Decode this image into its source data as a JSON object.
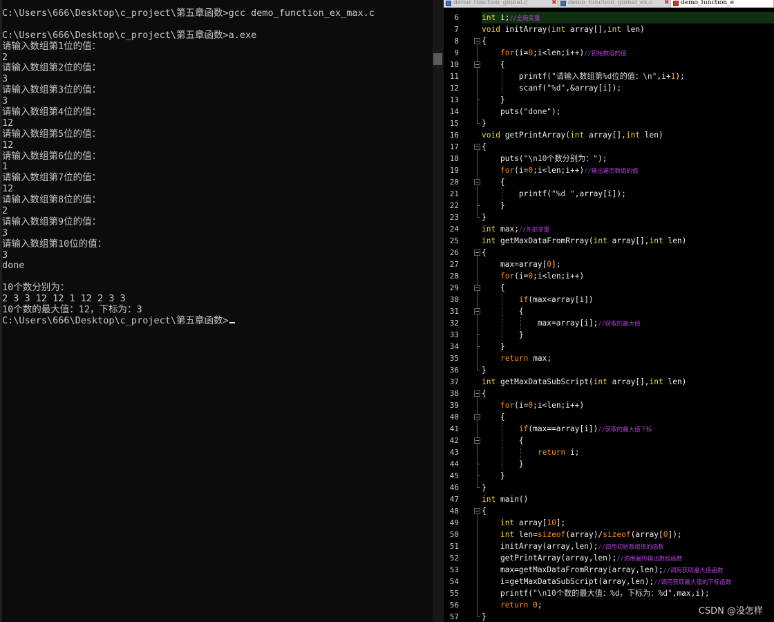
{
  "console": {
    "lines": [
      "C:\\Users\\666\\Desktop\\c_project\\第五章函数>gcc demo_function_ex_max.c",
      "",
      "C:\\Users\\666\\Desktop\\c_project\\第五章函数>a.exe",
      "请输入数组第1位的值：",
      "2",
      "请输入数组第2位的值：",
      "3",
      "请输入数组第3位的值：",
      "3",
      "请输入数组第4位的值：",
      "12",
      "请输入数组第5位的值：",
      "12",
      "请输入数组第6位的值：",
      "1",
      "请输入数组第7位的值：",
      "12",
      "请输入数组第8位的值：",
      "2",
      "请输入数组第9位的值：",
      "3",
      "请输入数组第10位的值：",
      "3",
      "done",
      "",
      "10个数分别为：",
      "2 3 3 12 12 1 12 2 3 3",
      "10个数的最大值：12，下标为：3",
      "C:\\Users\\666\\Desktop\\c_project\\第五章函数>"
    ]
  },
  "tabs": [
    {
      "label": "demo_function_global.c",
      "active": false
    },
    {
      "label": "demo_function_global_ex.c",
      "active": false
    },
    {
      "label": "demo_function_e",
      "active": true
    }
  ],
  "editor": {
    "lines": [
      {
        "n": "6",
        "t": [
          [
            "ty",
            "int"
          ],
          [
            "op",
            " i;"
          ],
          [
            "cm",
            "//全局变量"
          ]
        ]
      },
      {
        "n": "7",
        "t": [
          [
            "ty",
            "void"
          ],
          [
            "fn",
            " initArray("
          ],
          [
            "ty",
            "int"
          ],
          [
            "op",
            " array[],"
          ],
          [
            "ty",
            "int"
          ],
          [
            "op",
            " len)"
          ]
        ]
      },
      {
        "n": "8",
        "t": [
          [
            "op",
            "{"
          ]
        ]
      },
      {
        "n": "9",
        "t": [
          [
            "op",
            "    "
          ],
          [
            "kw",
            "for"
          ],
          [
            "op",
            "(i="
          ],
          [
            "num",
            "0"
          ],
          [
            "op",
            ";i<len;i++)"
          ],
          [
            "cm",
            "//初始数组的值"
          ]
        ]
      },
      {
        "n": "10",
        "t": [
          [
            "op",
            "    {"
          ]
        ]
      },
      {
        "n": "11",
        "t": [
          [
            "op",
            "        printf("
          ],
          [
            "str",
            "\"请输入数组第%d位的值：\\n\""
          ],
          [
            "op",
            ",i+"
          ],
          [
            "num",
            "1"
          ],
          [
            "op",
            ");"
          ]
        ]
      },
      {
        "n": "12",
        "t": [
          [
            "op",
            "        scanf("
          ],
          [
            "str",
            "\"%d\""
          ],
          [
            "op",
            ",&array[i]);"
          ]
        ]
      },
      {
        "n": "13",
        "t": [
          [
            "op",
            "    }"
          ]
        ]
      },
      {
        "n": "14",
        "t": [
          [
            "op",
            "    puts("
          ],
          [
            "str",
            "\"done\""
          ],
          [
            "op",
            ");"
          ]
        ]
      },
      {
        "n": "15",
        "t": [
          [
            "op",
            "}"
          ]
        ]
      },
      {
        "n": "16",
        "t": [
          [
            "ty",
            "void"
          ],
          [
            "fn",
            " getPrintArray("
          ],
          [
            "ty",
            "int"
          ],
          [
            "op",
            " array[],"
          ],
          [
            "ty",
            "int"
          ],
          [
            "op",
            " len)"
          ]
        ]
      },
      {
        "n": "17",
        "t": [
          [
            "op",
            "{"
          ]
        ]
      },
      {
        "n": "18",
        "t": [
          [
            "op",
            "    puts("
          ],
          [
            "str",
            "\"\\n10个数分别为：\""
          ],
          [
            "op",
            ");"
          ]
        ]
      },
      {
        "n": "19",
        "t": [
          [
            "op",
            "    "
          ],
          [
            "kw",
            "for"
          ],
          [
            "op",
            "(i="
          ],
          [
            "num",
            "0"
          ],
          [
            "op",
            ";i<len;i++)"
          ],
          [
            "cm",
            "//输出遍历数组的值"
          ]
        ]
      },
      {
        "n": "20",
        "t": [
          [
            "op",
            "    {"
          ]
        ]
      },
      {
        "n": "21",
        "t": [
          [
            "op",
            "        printf("
          ],
          [
            "str",
            "\"%d \""
          ],
          [
            "op",
            ",array[i]);"
          ]
        ]
      },
      {
        "n": "22",
        "t": [
          [
            "op",
            "    }"
          ]
        ]
      },
      {
        "n": "23",
        "t": [
          [
            "op",
            "}"
          ]
        ]
      },
      {
        "n": "24",
        "t": [
          [
            "ty",
            "int"
          ],
          [
            "op",
            " max;"
          ],
          [
            "cm",
            "//外部变量"
          ]
        ]
      },
      {
        "n": "25",
        "t": [
          [
            "ty",
            "int"
          ],
          [
            "fn",
            " getMaxDataFromRrray("
          ],
          [
            "ty",
            "int"
          ],
          [
            "op",
            " array[],"
          ],
          [
            "ty",
            "int"
          ],
          [
            "op",
            " len)"
          ]
        ]
      },
      {
        "n": "26",
        "t": [
          [
            "op",
            "{"
          ]
        ]
      },
      {
        "n": "27",
        "t": [
          [
            "op",
            "    max=array["
          ],
          [
            "num",
            "0"
          ],
          [
            "op",
            "];"
          ]
        ]
      },
      {
        "n": "28",
        "t": [
          [
            "op",
            "    "
          ],
          [
            "kw",
            "for"
          ],
          [
            "op",
            "(i="
          ],
          [
            "num",
            "0"
          ],
          [
            "op",
            ";i<len;i++)"
          ]
        ]
      },
      {
        "n": "29",
        "t": [
          [
            "op",
            "    {"
          ]
        ]
      },
      {
        "n": "30",
        "t": [
          [
            "op",
            "        "
          ],
          [
            "kw",
            "if"
          ],
          [
            "op",
            "(max<array[i])"
          ]
        ]
      },
      {
        "n": "31",
        "t": [
          [
            "op",
            "        {"
          ]
        ]
      },
      {
        "n": "32",
        "t": [
          [
            "op",
            "            max=array[i];"
          ],
          [
            "cm",
            "//获取的最大值"
          ]
        ]
      },
      {
        "n": "33",
        "t": [
          [
            "op",
            "        }"
          ]
        ]
      },
      {
        "n": "34",
        "t": [
          [
            "op",
            "    }"
          ]
        ]
      },
      {
        "n": "35",
        "t": [
          [
            "op",
            "    "
          ],
          [
            "kw",
            "return"
          ],
          [
            "op",
            " max;"
          ]
        ]
      },
      {
        "n": "36",
        "t": [
          [
            "op",
            "}"
          ]
        ]
      },
      {
        "n": "37",
        "t": [
          [
            "ty",
            "int"
          ],
          [
            "fn",
            " getMaxDataSubScript("
          ],
          [
            "ty",
            "int"
          ],
          [
            "op",
            " array[],"
          ],
          [
            "ty",
            "int"
          ],
          [
            "op",
            " len)"
          ]
        ]
      },
      {
        "n": "38",
        "t": [
          [
            "op",
            "{"
          ]
        ]
      },
      {
        "n": "39",
        "t": [
          [
            "op",
            "    "
          ],
          [
            "kw",
            "for"
          ],
          [
            "op",
            "(i="
          ],
          [
            "num",
            "0"
          ],
          [
            "op",
            ";i<len;i++)"
          ]
        ]
      },
      {
        "n": "40",
        "t": [
          [
            "op",
            "    {"
          ]
        ]
      },
      {
        "n": "41",
        "t": [
          [
            "op",
            "        "
          ],
          [
            "kw",
            "if"
          ],
          [
            "op",
            "(max==array[i])"
          ],
          [
            "cm",
            "//获取的最大值下标"
          ]
        ]
      },
      {
        "n": "42",
        "t": [
          [
            "op",
            "        {"
          ]
        ]
      },
      {
        "n": "43",
        "t": [
          [
            "op",
            "            "
          ],
          [
            "kw",
            "return"
          ],
          [
            "op",
            " i;"
          ]
        ]
      },
      {
        "n": "44",
        "t": [
          [
            "op",
            "        }"
          ]
        ]
      },
      {
        "n": "45",
        "t": [
          [
            "op",
            "    }"
          ]
        ]
      },
      {
        "n": "46",
        "t": [
          [
            "op",
            "}"
          ]
        ]
      },
      {
        "n": "47",
        "t": [
          [
            "ty",
            "int"
          ],
          [
            "fn",
            " main()"
          ]
        ]
      },
      {
        "n": "48",
        "t": [
          [
            "op",
            "{"
          ]
        ]
      },
      {
        "n": "49",
        "t": [
          [
            "op",
            "    "
          ],
          [
            "ty",
            "int"
          ],
          [
            "op",
            " array["
          ],
          [
            "num",
            "10"
          ],
          [
            "op",
            "];"
          ]
        ]
      },
      {
        "n": "50",
        "t": [
          [
            "op",
            "    "
          ],
          [
            "ty",
            "int"
          ],
          [
            "op",
            " len="
          ],
          [
            "kw",
            "sizeof"
          ],
          [
            "op",
            "(array)/"
          ],
          [
            "kw",
            "sizeof"
          ],
          [
            "op",
            "(array["
          ],
          [
            "num",
            "0"
          ],
          [
            "op",
            "]);"
          ]
        ]
      },
      {
        "n": "51",
        "t": [
          [
            "op",
            "    initArray(array,len);"
          ],
          [
            "cm",
            "//调用初始数组值的函数"
          ]
        ]
      },
      {
        "n": "52",
        "t": [
          [
            "op",
            "    getPrintArray(array,len);"
          ],
          [
            "cm",
            "//调用遍历输出数组函数"
          ]
        ]
      },
      {
        "n": "53",
        "t": [
          [
            "op",
            "    max=getMaxDataFromRrray(array,len);"
          ],
          [
            "cm",
            "//调用获取最大值函数"
          ]
        ]
      },
      {
        "n": "54",
        "t": [
          [
            "op",
            "    i=getMaxDataSubScript(array,len);"
          ],
          [
            "cm",
            "//调用获取最大值的下标函数"
          ]
        ]
      },
      {
        "n": "55",
        "t": [
          [
            "op",
            "    printf("
          ],
          [
            "str",
            "\"\\n10个数的最大值：%d，下标为：%d\""
          ],
          [
            "op",
            ",max,i);"
          ]
        ]
      },
      {
        "n": "56",
        "t": [
          [
            "op",
            "    "
          ],
          [
            "kw",
            "return"
          ],
          [
            "op",
            " "
          ],
          [
            "num",
            "0"
          ],
          [
            "op",
            ";"
          ]
        ]
      },
      {
        "n": "57",
        "t": [
          [
            "op",
            "}"
          ]
        ]
      }
    ]
  },
  "watermark": "CSDN @没怎样"
}
